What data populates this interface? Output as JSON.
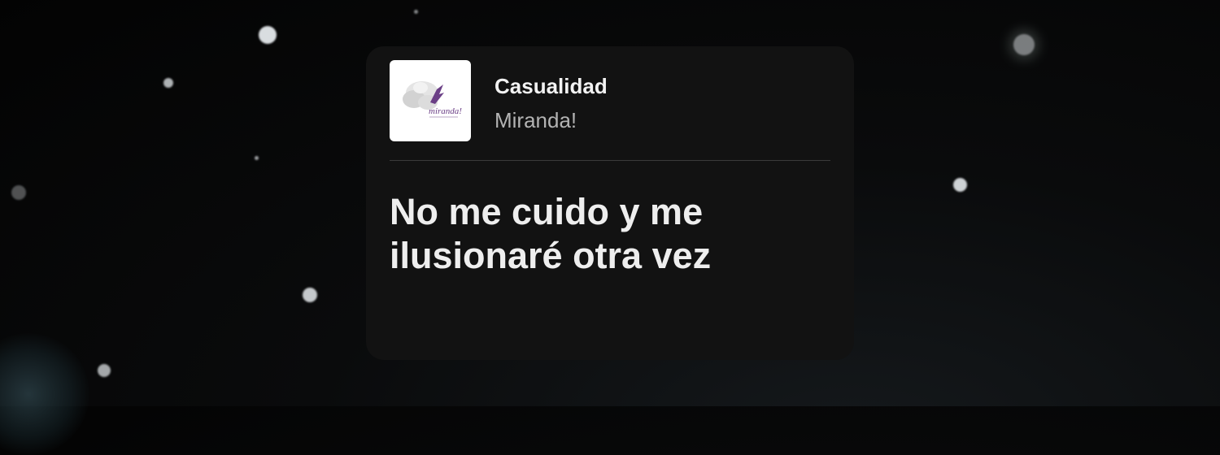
{
  "card": {
    "track_title": "Casualidad",
    "artist": "Miranda!",
    "lyric": "No me cuido y me ilusionaré otra vez"
  },
  "album_art": {
    "logo_text": "miranda!",
    "accent_color": "#6b3f86"
  },
  "colors": {
    "card_background": "#121212",
    "title": "#f2f2f2",
    "artist": "#b3b3b3",
    "lyric": "#eeeeee"
  }
}
